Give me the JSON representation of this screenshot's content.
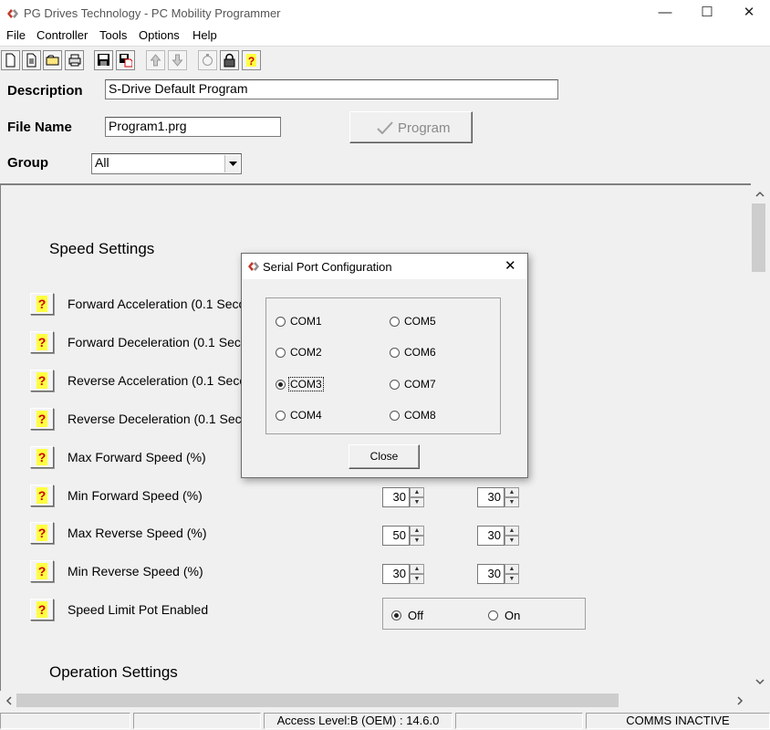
{
  "window": {
    "title": "PG Drives Technology - PC Mobility Programmer",
    "controls": {
      "minimize": "—",
      "maximize": "☐",
      "close": "✕"
    }
  },
  "menu": [
    "File",
    "Controller",
    "Tools",
    "Options",
    "Help"
  ],
  "header": {
    "description_label": "Description",
    "description_value": "S-Drive  Default Program",
    "filename_label": "File Name",
    "filename_value": "Program1.prg",
    "program_button": "Program",
    "group_label": "Group",
    "group_value": "All"
  },
  "speed_settings": {
    "title": "Speed Settings",
    "help_glyph": "?",
    "rows": [
      {
        "label": "Forward Acceleration (0.1 Seco"
      },
      {
        "label": "Forward Deceleration (0.1 Seco"
      },
      {
        "label": "Reverse Acceleration (0.1 Seco"
      },
      {
        "label": "Reverse Deceleration (0.1 Seco"
      },
      {
        "label": "Max Forward Speed (%)"
      },
      {
        "label": "Min Forward Speed (%)",
        "value1": "30",
        "value2": "30"
      },
      {
        "label": "Max Reverse Speed (%)",
        "value1": "50",
        "value2": "30"
      },
      {
        "label": "Min Reverse Speed (%)",
        "value1": "30",
        "value2": "30"
      },
      {
        "label": "Speed Limit Pot Enabled",
        "option_off": "Off",
        "option_on": "On",
        "selected": "Off"
      }
    ]
  },
  "operation_settings": {
    "title": "Operation Settings"
  },
  "statusbar": {
    "access": "Access Level:B (OEM) : 14.6.0",
    "comms": "COMMS INACTIVE"
  },
  "dialog": {
    "title": "Serial Port Configuration",
    "close_x": "✕",
    "ports": [
      "COM1",
      "COM2",
      "COM3",
      "COM4",
      "COM5",
      "COM6",
      "COM7",
      "COM8"
    ],
    "selected": "COM3",
    "close_button": "Close"
  },
  "colors": {
    "accent_red": "#c0392b",
    "help_yellow": "#ffff40",
    "help_red": "#cc0000"
  }
}
